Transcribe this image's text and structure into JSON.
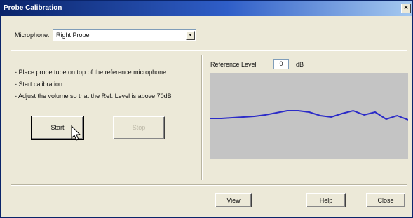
{
  "window": {
    "title": "Probe Calibration",
    "close_glyph": "×"
  },
  "microphone": {
    "label": "Microphone:",
    "value": "Right Probe"
  },
  "instructions": [
    "- Place probe tube on top of the reference microphone.",
    "- Start calibration.",
    "- Adjust the volume so that the Ref. Level is above 70dB"
  ],
  "buttons": {
    "start": "Start",
    "stop": "Stop",
    "view": "View",
    "help": "Help",
    "close": "Close"
  },
  "reference": {
    "label": "Reference Level",
    "value": "0",
    "unit": "dB"
  },
  "graph": {
    "line_color": "#2b2bc8",
    "background": "#c4c4c4",
    "trace": [
      168,
      168,
      167,
      166,
      165,
      163,
      160,
      157,
      157,
      159,
      164,
      166,
      161,
      157,
      163,
      159,
      169,
      164,
      170
    ]
  },
  "icons": {
    "cursor": "mouse-pointer-icon",
    "dropdown": "chevron-down-icon"
  }
}
